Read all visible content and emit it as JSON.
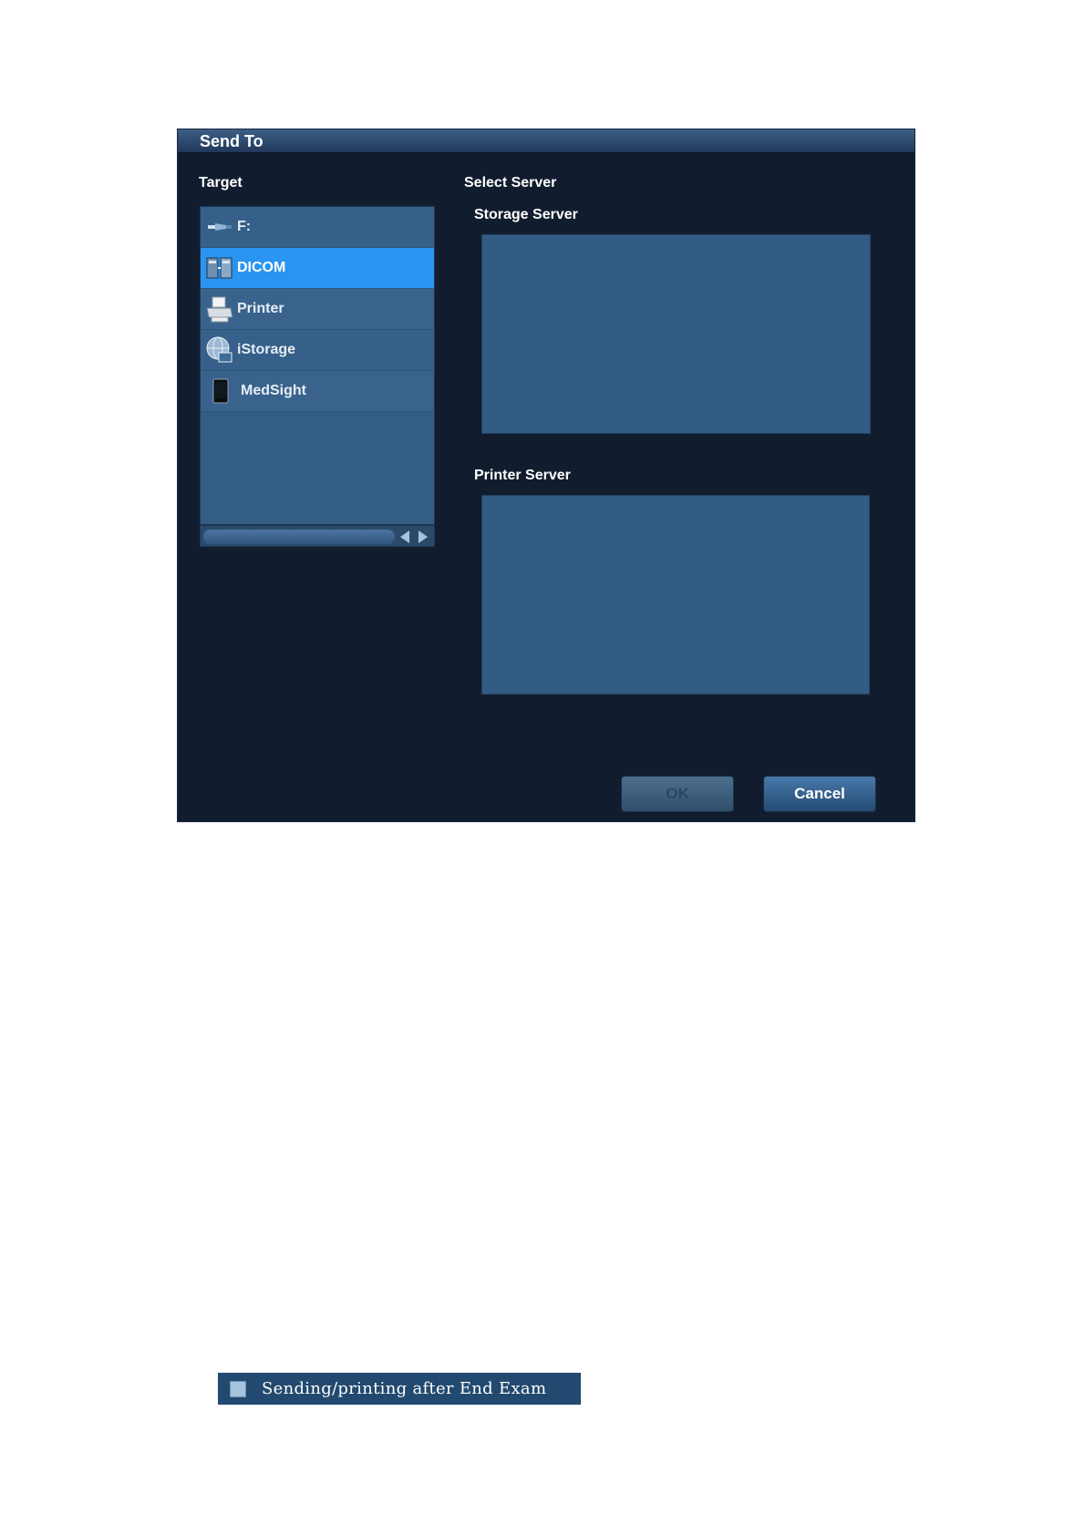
{
  "dialog": {
    "title": "Send To",
    "target_label": "Target",
    "select_server_label": "Select Server",
    "storage_server_label": "Storage Server",
    "printer_server_label": "Printer Server",
    "targets": [
      {
        "label": "F:",
        "icon": "usb-drive-icon",
        "selected": false
      },
      {
        "label": "DICOM",
        "icon": "dicom-icon",
        "selected": true
      },
      {
        "label": "Printer",
        "icon": "printer-icon",
        "selected": false
      },
      {
        "label": "iStorage",
        "icon": "istorage-globe-icon",
        "selected": false
      },
      {
        "label": "MedSight",
        "icon": "mobile-device-icon",
        "selected": false
      }
    ],
    "ok_label": "OK",
    "cancel_label": "Cancel"
  },
  "option": {
    "label": "Sending/printing after End Exam",
    "checked": false
  },
  "colors": {
    "dialog_bg": "#111d2e",
    "panel_bg": "#335c85",
    "selected": "#2a95f0"
  }
}
